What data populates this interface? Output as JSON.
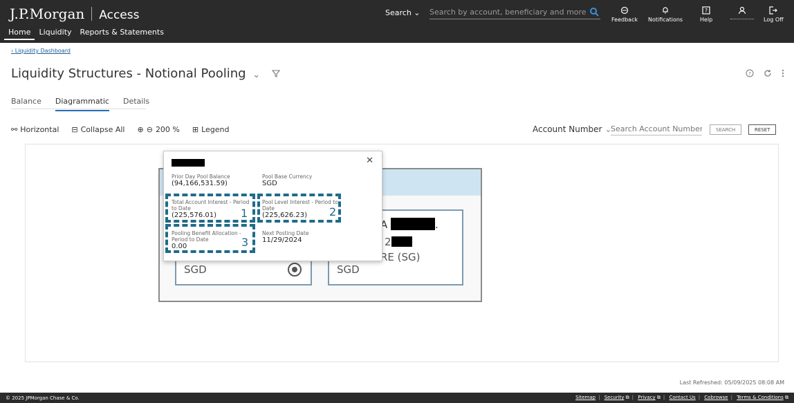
{
  "header": {
    "brand": "J.P.Morgan",
    "product": "Access",
    "nav": [
      "Home",
      "Liquidity",
      "Reports & Statements"
    ],
    "search_label": "Search",
    "search_placeholder": "Search by account, beneficiary and more",
    "tools": [
      {
        "label": "Feedback",
        "icon": "feedback-icon"
      },
      {
        "label": "Notifications",
        "icon": "bell-icon"
      },
      {
        "label": "Help",
        "icon": "help-icon"
      },
      {
        "label": "",
        "icon": "user-icon"
      },
      {
        "label": "Log Off",
        "icon": "logoff-icon"
      }
    ]
  },
  "breadcrumb": "Liquidity Dashboard",
  "page": {
    "title": "Liquidity Structures - Notional Pooling",
    "tabs": [
      "Balance",
      "Diagrammatic",
      "Details"
    ],
    "active_tab": "Diagrammatic"
  },
  "toolbar": {
    "horizontal": "Horizontal",
    "collapse_all": "Collapse All",
    "zoom": "200 %",
    "legend": "Legend",
    "account_select": "Account Number",
    "search_placeholder": "Search Account Number",
    "search_btn": "SEARCH",
    "reset_btn": "RESET"
  },
  "diagram": {
    "card1_currency": "SGD",
    "card2_currency": "SGD",
    "card2_line1": "A",
    "card2_line2": "2",
    "card2_line3": "RE (SG)"
  },
  "popup": {
    "fields": {
      "prior_day_balance": {
        "label": "Prior Day Pool Balance",
        "value": "(94,166,531.59)"
      },
      "pool_base_currency": {
        "label": "Pool Base Currency",
        "value": "SGD"
      },
      "total_account_interest": {
        "label": "Total Account Interest - Period to Date",
        "value": "(225,576.01)"
      },
      "pool_level_interest": {
        "label": "Pool Level Interest - Period to Date",
        "value": "(225,626.23)"
      },
      "pooling_benefit": {
        "label": "Pooling Benefit Allocation - Period to Date",
        "value": "0.00"
      },
      "next_posting_date": {
        "label": "Next Posting Date",
        "value": "11/29/2024"
      }
    },
    "annotations": [
      "1",
      "2",
      "3"
    ]
  },
  "last_refreshed": "Last Refreshed: 05/09/2025 08:08 AM",
  "footer": {
    "copyright": "© 2025 JPMorgan Chase & Co.",
    "links": [
      "Sitemap",
      "Security",
      "Privacy",
      "Contact Us",
      "Cobrowse",
      "Terms & Conditions"
    ]
  },
  "colors": {
    "header_bg": "#2b2b2b",
    "accent": "#1f6fb2",
    "annotation": "#1f6b8a"
  }
}
